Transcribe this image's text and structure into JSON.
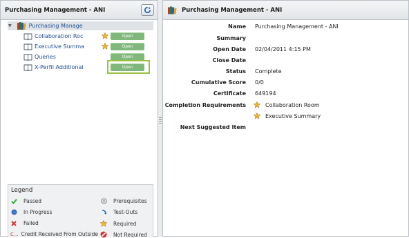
{
  "left_panel": {
    "title": "Purchasing Management - ANI",
    "tree_root": "Purchasing Manage",
    "items": [
      {
        "label": "Collaboration Roc",
        "required": true,
        "action": "Open"
      },
      {
        "label": "Executive Summa",
        "required": true,
        "action": "Open"
      },
      {
        "label": "Queries",
        "required": false,
        "action": "Open"
      },
      {
        "label": "X-Perfil Additional",
        "required": false,
        "action": "Open"
      }
    ]
  },
  "legend": {
    "title": "Legend",
    "entries": [
      {
        "label": "Passed",
        "icon": "check-icon"
      },
      {
        "label": "Prerequisites",
        "icon": "prerequisites-icon"
      },
      {
        "label": "In Progress",
        "icon": "in-progress-icon"
      },
      {
        "label": "Test-Outs",
        "icon": "test-out-icon"
      },
      {
        "label": "Failed",
        "icon": "failed-icon"
      },
      {
        "label": "Required",
        "icon": "star-icon"
      },
      {
        "label": "Credit Received From Outside",
        "icon": "credit-icon"
      },
      {
        "label": "Not Required",
        "icon": "not-required-icon"
      }
    ],
    "credit_icon_text": "C..."
  },
  "right_panel": {
    "title": "Purchasing Management - ANI",
    "details": [
      {
        "key": "Name",
        "value": "Purchasing Management - ANI"
      },
      {
        "key": "Summary",
        "value": ""
      },
      {
        "key": "Open Date",
        "value": "02/04/2011 4:15 PM"
      },
      {
        "key": "Close Date",
        "value": ""
      },
      {
        "key": "Status",
        "value": "Complete"
      },
      {
        "key": "Cumulative Score",
        "value": "0/0"
      },
      {
        "key": "Certificate",
        "value": "649194"
      }
    ],
    "completion_label": "Completion Requirements",
    "completion_items": [
      "Collaboration Room",
      "Executive Summary"
    ],
    "next_label": "Next Suggested Item"
  },
  "colors": {
    "open_button": "#7fb87a",
    "focus_border": "#9bc23d",
    "link": "#1e4f91"
  }
}
